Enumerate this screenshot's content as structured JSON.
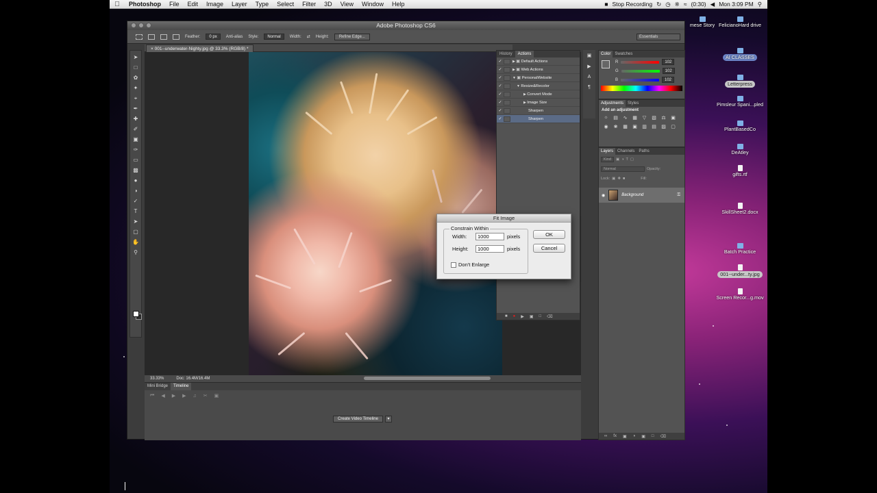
{
  "menubar": {
    "app_name": "Photoshop",
    "items": [
      "File",
      "Edit",
      "Image",
      "Layer",
      "Type",
      "Select",
      "Filter",
      "3D",
      "View",
      "Window",
      "Help"
    ],
    "status_recording": "Stop Recording",
    "battery": "(0:30)",
    "clock": "Mon 3:09 PM"
  },
  "window": {
    "title": "Adobe Photoshop CS6"
  },
  "options_bar": {
    "feather_label": "Feather:",
    "feather_value": "0 px",
    "anti_alias_label": "Anti-alias",
    "style_label": "Style:",
    "style_value": "Normal",
    "width_label": "Width:",
    "height_label": "Height:",
    "refine_edge": "Refine Edge...",
    "workspace": "Essentials"
  },
  "document": {
    "tab_title": "001--underwater-Nighty.jpg @ 33.3% (RGB/8) *",
    "zoom": "33.33%",
    "doc_size": "Doc: 16.4M/16.4M"
  },
  "timeline_panel": {
    "tabs": [
      "Mini Bridge",
      "Timeline"
    ],
    "create_button": "Create Video Timeline"
  },
  "actions_panel": {
    "tabs": [
      "History",
      "Actions"
    ],
    "rows": [
      {
        "label": "Default Actions",
        "checked": "✓",
        "indent": 0,
        "selected": false
      },
      {
        "label": "Web Actions",
        "checked": "✓",
        "indent": 0,
        "selected": false
      },
      {
        "label": "PersonalWebsite",
        "checked": "✓",
        "indent": 0,
        "selected": false
      },
      {
        "label": "Resize&Recolor",
        "checked": "✓",
        "indent": 1,
        "selected": false
      },
      {
        "label": "Convert Mode",
        "checked": "✓",
        "indent": 2,
        "selected": false
      },
      {
        "label": "Image Size",
        "checked": "✓",
        "indent": 2,
        "selected": false
      },
      {
        "label": "Sharpen",
        "checked": "✓",
        "indent": 2,
        "selected": false
      },
      {
        "label": "Sharpen",
        "checked": "✓",
        "indent": 2,
        "selected": true
      }
    ]
  },
  "color_panel": {
    "tabs": [
      "Color",
      "Swatches"
    ],
    "r_label": "R",
    "g_label": "G",
    "b_label": "B",
    "r": "102",
    "g": "102",
    "b": "102"
  },
  "adjustments_panel": {
    "tabs": [
      "Adjustments",
      "Styles"
    ],
    "title": "Add an adjustment"
  },
  "layers_panel": {
    "tabs": [
      "Layers",
      "Channels",
      "Paths"
    ],
    "kind": "Kind",
    "blend_mode": "Normal",
    "opacity_label": "Opacity:",
    "lock_label": "Lock:",
    "fill_label": "Fill:",
    "layer_name": "Background"
  },
  "dialog": {
    "title": "Fit Image",
    "group_label": "Constrain Within",
    "width_label": "Width:",
    "width_value": "1000",
    "height_label": "Height:",
    "height_value": "1000",
    "unit": "pixels",
    "dont_enlarge": "Don't Enlarge",
    "ok": "OK",
    "cancel": "Cancel"
  },
  "desktop": {
    "icons": [
      {
        "label": "mese Story",
        "style": "plain"
      },
      {
        "label": "FelicianoHard drive",
        "style": "plain"
      },
      {
        "label": "AI CLASSES",
        "style": "pill"
      },
      {
        "label": "Letterpress",
        "style": "pill-light"
      },
      {
        "label": "Pimsleur Spani...pled",
        "style": "plain"
      },
      {
        "label": "PlantBasedCo",
        "style": "plain"
      },
      {
        "label": "DeAtley",
        "style": "plain"
      },
      {
        "label": "gifts.rtf",
        "style": "doc"
      },
      {
        "label": "SkillSheet2.docx",
        "style": "doc"
      },
      {
        "label": "Batch Practice",
        "style": "plain"
      },
      {
        "label": "001--under...ty.jpg",
        "style": "pill-light"
      },
      {
        "label": "Screen Recor...g.mov",
        "style": "doc"
      }
    ]
  }
}
